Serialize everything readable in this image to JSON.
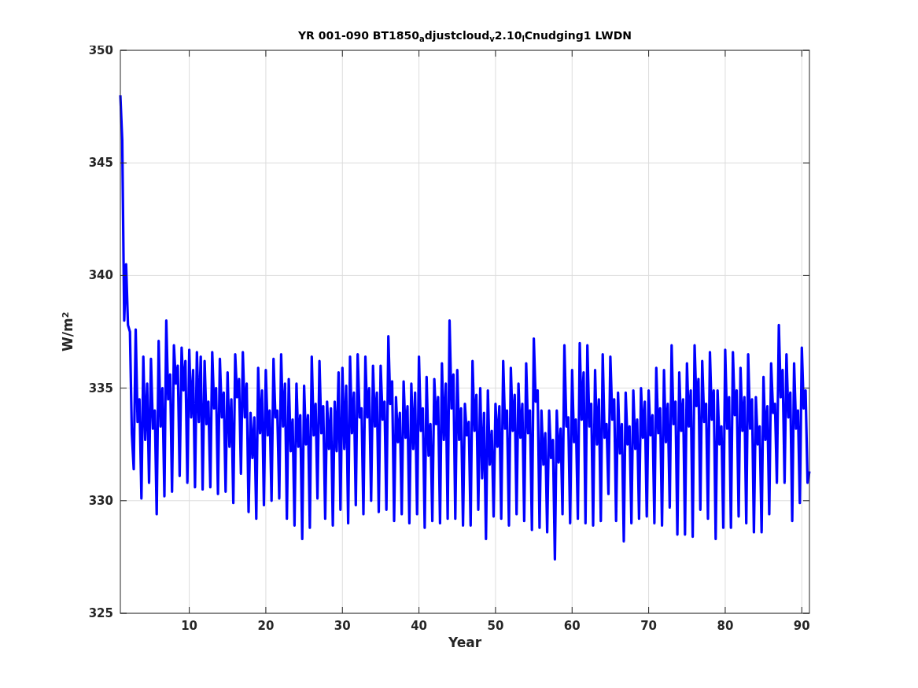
{
  "figure": {
    "chart_data": {
      "type": "line",
      "title": "YR 001-090 BT1850$_{a}$djustcloud$_{v}$2.10$_{l}$Cnudging1 LWDN",
      "xlabel": "Year",
      "ylabel": "W/m$^{2}$",
      "grid": true,
      "xlim": [
        1,
        91
      ],
      "ylim": [
        325,
        350
      ],
      "xticks": [
        10,
        20,
        30,
        40,
        50,
        60,
        70,
        80,
        90
      ],
      "yticks": [
        325,
        330,
        335,
        340,
        345,
        350
      ],
      "x": [
        1,
        1.25,
        1.5,
        1.75,
        2,
        2.25,
        2.5,
        2.75,
        3,
        3.25,
        3.5,
        3.75,
        4,
        4.25,
        4.5,
        4.75,
        5,
        5.25,
        5.5,
        5.75,
        6,
        6.25,
        6.5,
        6.75,
        7,
        7.25,
        7.5,
        7.75,
        8,
        8.25,
        8.5,
        8.75,
        9,
        9.25,
        9.5,
        9.75,
        10,
        10.25,
        10.5,
        10.75,
        11,
        11.25,
        11.5,
        11.75,
        12,
        12.25,
        12.5,
        12.75,
        13,
        13.25,
        13.5,
        13.75,
        14,
        14.25,
        14.5,
        14.75,
        15,
        15.25,
        15.5,
        15.75,
        16,
        16.25,
        16.5,
        16.75,
        17,
        17.25,
        17.5,
        17.75,
        18,
        18.25,
        18.5,
        18.75,
        19,
        19.25,
        19.5,
        19.75,
        20,
        20.25,
        20.5,
        20.75,
        21,
        21.25,
        21.5,
        21.75,
        22,
        22.25,
        22.5,
        22.75,
        23,
        23.25,
        23.5,
        23.75,
        24,
        24.25,
        24.5,
        24.75,
        25,
        25.25,
        25.5,
        25.75,
        26,
        26.25,
        26.5,
        26.75,
        27,
        27.25,
        27.5,
        27.75,
        28,
        28.25,
        28.5,
        28.75,
        29,
        29.25,
        29.5,
        29.75,
        30,
        30.25,
        30.5,
        30.75,
        31,
        31.25,
        31.5,
        31.75,
        32,
        32.25,
        32.5,
        32.75,
        33,
        33.25,
        33.5,
        33.75,
        34,
        34.25,
        34.5,
        34.75,
        35,
        35.25,
        35.5,
        35.75,
        36,
        36.25,
        36.5,
        36.75,
        37,
        37.25,
        37.5,
        37.75,
        38,
        38.25,
        38.5,
        38.75,
        39,
        39.25,
        39.5,
        39.75,
        40,
        40.25,
        40.5,
        40.75,
        41,
        41.25,
        41.5,
        41.75,
        42,
        42.25,
        42.5,
        42.75,
        43,
        43.25,
        43.5,
        43.75,
        44,
        44.25,
        44.5,
        44.75,
        45,
        45.25,
        45.5,
        45.75,
        46,
        46.25,
        46.5,
        46.75,
        47,
        47.25,
        47.5,
        47.75,
        48,
        48.25,
        48.5,
        48.75,
        49,
        49.25,
        49.5,
        49.75,
        50,
        50.25,
        50.5,
        50.75,
        51,
        51.25,
        51.5,
        51.75,
        52,
        52.25,
        52.5,
        52.75,
        53,
        53.25,
        53.5,
        53.75,
        54,
        54.25,
        54.5,
        54.75,
        55,
        55.25,
        55.5,
        55.75,
        56,
        56.25,
        56.5,
        56.75,
        57,
        57.25,
        57.5,
        57.75,
        58,
        58.25,
        58.5,
        58.75,
        59,
        59.25,
        59.5,
        59.75,
        60,
        60.25,
        60.5,
        60.75,
        61,
        61.25,
        61.5,
        61.75,
        62,
        62.25,
        62.5,
        62.75,
        63,
        63.25,
        63.5,
        63.75,
        64,
        64.25,
        64.5,
        64.75,
        65,
        65.25,
        65.5,
        65.75,
        66,
        66.25,
        66.5,
        66.75,
        67,
        67.25,
        67.5,
        67.75,
        68,
        68.25,
        68.5,
        68.75,
        69,
        69.25,
        69.5,
        69.75,
        70,
        70.25,
        70.5,
        70.75,
        71,
        71.25,
        71.5,
        71.75,
        72,
        72.25,
        72.5,
        72.75,
        73,
        73.25,
        73.5,
        73.75,
        74,
        74.25,
        74.5,
        74.75,
        75,
        75.25,
        75.5,
        75.75,
        76,
        76.25,
        76.5,
        76.75,
        77,
        77.25,
        77.5,
        77.75,
        78,
        78.25,
        78.5,
        78.75,
        79,
        79.25,
        79.5,
        79.75,
        80,
        80.25,
        80.5,
        80.75,
        81,
        81.25,
        81.5,
        81.75,
        82,
        82.25,
        82.5,
        82.75,
        83,
        83.25,
        83.5,
        83.75,
        84,
        84.25,
        84.5,
        84.75,
        85,
        85.25,
        85.5,
        85.75,
        86,
        86.25,
        86.5,
        86.75,
        87,
        87.25,
        87.5,
        87.75,
        88,
        88.25,
        88.5,
        88.75,
        89,
        89.25,
        89.5,
        89.75,
        90,
        90.25,
        90.5,
        90.75,
        91
      ],
      "series": [
        {
          "color": "#0000ff",
          "values": [
            348,
            346,
            338,
            340.5,
            337.8,
            337.5,
            333,
            331.4,
            337.6,
            333.5,
            334.5,
            330.1,
            336.4,
            332.7,
            335.2,
            330.8,
            336.3,
            333.2,
            334,
            329.4,
            337.1,
            333.3,
            335,
            330.2,
            338,
            334.5,
            335.6,
            330.4,
            336.9,
            335.2,
            336,
            331.1,
            336.8,
            334.9,
            336.2,
            330.8,
            336.7,
            333.7,
            335.8,
            330.6,
            336.6,
            333.5,
            336.4,
            330.5,
            336.2,
            333.4,
            334.4,
            330.6,
            336.6,
            334.1,
            335,
            330.3,
            336.3,
            333.7,
            334.8,
            330.4,
            335.7,
            332.4,
            334.5,
            329.9,
            336.5,
            334.6,
            335.4,
            331.2,
            336.6,
            333.7,
            335.2,
            329.5,
            333.9,
            331.9,
            333.7,
            329.2,
            335.9,
            333,
            334.9,
            329.8,
            335.8,
            332.9,
            334,
            330,
            336.3,
            333.7,
            334,
            330.1,
            336.5,
            333.3,
            335.2,
            329.2,
            335.4,
            332.2,
            333.6,
            328.9,
            335.2,
            332.4,
            333.8,
            328.3,
            335.1,
            332.5,
            333.8,
            328.8,
            336.4,
            332.9,
            334.3,
            330.1,
            336.2,
            333,
            334.2,
            329.2,
            334.4,
            332.3,
            334.1,
            328.9,
            334.4,
            332.2,
            335.7,
            329.6,
            335.9,
            332.3,
            335.1,
            329,
            336.4,
            333,
            334.8,
            329.8,
            336.5,
            333.7,
            334.1,
            329.4,
            336.4,
            333.7,
            335,
            330,
            336,
            333.3,
            334.8,
            329.5,
            336,
            333.6,
            334.4,
            329.6,
            337.3,
            334.3,
            335.3,
            329.1,
            334.6,
            332.6,
            333.9,
            329.4,
            335.3,
            332.8,
            334.2,
            329,
            335.2,
            332.3,
            334.8,
            329.4,
            336.4,
            333.1,
            334.1,
            328.8,
            335.5,
            332,
            333.4,
            329.1,
            335.4,
            333.4,
            334.6,
            329,
            336.1,
            332.7,
            335.2,
            329.2,
            338,
            334.1,
            335.6,
            329.2,
            335.8,
            332.7,
            334.1,
            328.9,
            334.3,
            332.9,
            333.5,
            328.9,
            336.2,
            333.1,
            334.7,
            329.6,
            335,
            331,
            333.9,
            328.3,
            334.9,
            331.6,
            333.1,
            329.3,
            334.3,
            332.4,
            334.2,
            329.2,
            336.2,
            333.2,
            334,
            328.9,
            335.9,
            333.1,
            334.7,
            329.4,
            335.2,
            332.8,
            334.3,
            329.1,
            336.1,
            333,
            334,
            328.7,
            337.2,
            334.4,
            334.9,
            328.8,
            334,
            331.6,
            333,
            328.6,
            334,
            331.9,
            332.7,
            327.4,
            334,
            331.7,
            333.2,
            329.4,
            336.9,
            333.3,
            333.7,
            329,
            335.8,
            332.6,
            333.6,
            329.2,
            337,
            333.6,
            335.7,
            329,
            336.9,
            333.3,
            334.3,
            328.9,
            335.8,
            332.5,
            334.5,
            329.1,
            336.5,
            332.8,
            333.4,
            330.3,
            336.4,
            333.6,
            334.5,
            329.1,
            334.8,
            332.1,
            333.4,
            328.2,
            334.8,
            332.5,
            333.3,
            329,
            334.9,
            332.3,
            333.6,
            329.2,
            335,
            332.8,
            334.4,
            329.3,
            334.9,
            332.9,
            333.8,
            329,
            335.9,
            333,
            334.1,
            328.9,
            335.8,
            332.6,
            334.3,
            329.7,
            336.9,
            333.4,
            334.4,
            328.5,
            335.7,
            333.1,
            334.5,
            328.5,
            336.1,
            333.3,
            334.9,
            328.4,
            336.9,
            334.2,
            335.4,
            329.6,
            336.2,
            333.5,
            334.3,
            329.2,
            336.6,
            333.6,
            334.9,
            328.3,
            334.9,
            332.5,
            333.3,
            328.8,
            336.7,
            333.2,
            334.6,
            328.8,
            336.6,
            333.8,
            334.9,
            329.3,
            335.9,
            333.1,
            334.6,
            329,
            336.5,
            333.2,
            334.5,
            328.6,
            334.6,
            332.5,
            333.3,
            328.6,
            335.5,
            332.7,
            334.2,
            329.4,
            336.1,
            333.9,
            334.3,
            330.8,
            337.8,
            334.6,
            335.8,
            330.8,
            336.5,
            333.7,
            334.8,
            329.1,
            336.1,
            333.2,
            334,
            329.9,
            336.8,
            334.1,
            334.9,
            330.8,
            331.3
          ]
        }
      ]
    }
  }
}
